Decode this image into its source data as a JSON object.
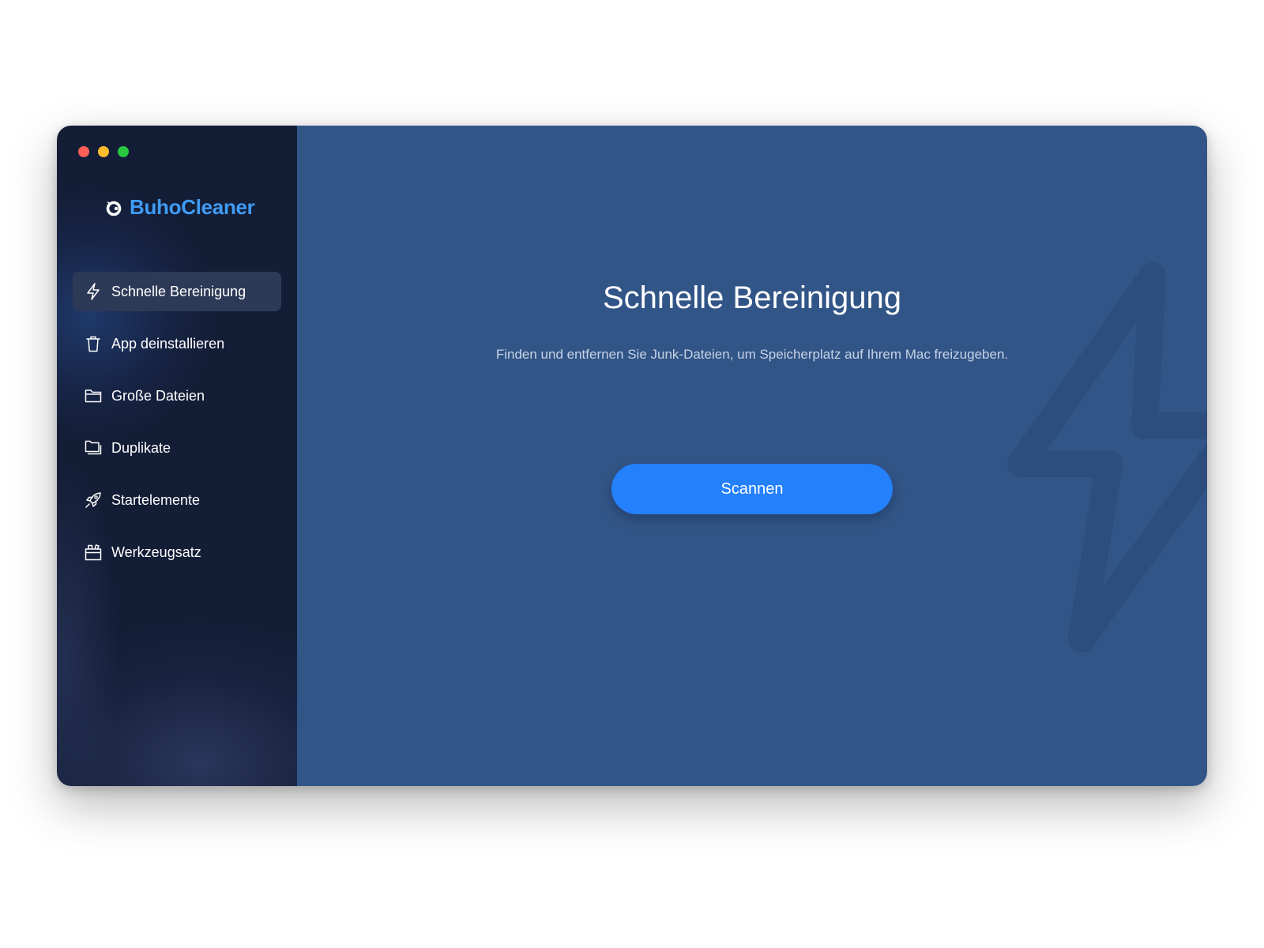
{
  "app": {
    "name": "BuhoCleaner",
    "brand_color": "#3f9cf5",
    "accent_color": "#2480fb"
  },
  "window": {
    "traffic_lights": [
      {
        "name": "close",
        "color": "#fe5f57"
      },
      {
        "name": "minimize",
        "color": "#febc2e"
      },
      {
        "name": "maximize",
        "color": "#28c840"
      }
    ]
  },
  "sidebar": {
    "items": [
      {
        "label": "Schnelle Bereinigung",
        "icon": "lightning-icon",
        "active": true
      },
      {
        "label": "App deinstallieren",
        "icon": "trash-icon",
        "active": false
      },
      {
        "label": "Große Dateien",
        "icon": "folder-icon",
        "active": false
      },
      {
        "label": "Duplikate",
        "icon": "duplicate-folder-icon",
        "active": false
      },
      {
        "label": "Startelemente",
        "icon": "rocket-icon",
        "active": false
      },
      {
        "label": "Werkzeugsatz",
        "icon": "toolbox-icon",
        "active": false
      }
    ]
  },
  "main": {
    "title": "Schnelle Bereinigung",
    "subtitle": "Finden und entfernen Sie Junk-Dateien, um Speicherplatz auf Ihrem Mac freizugeben.",
    "scan_label": "Scannen",
    "background_icon": "lightning-icon"
  }
}
